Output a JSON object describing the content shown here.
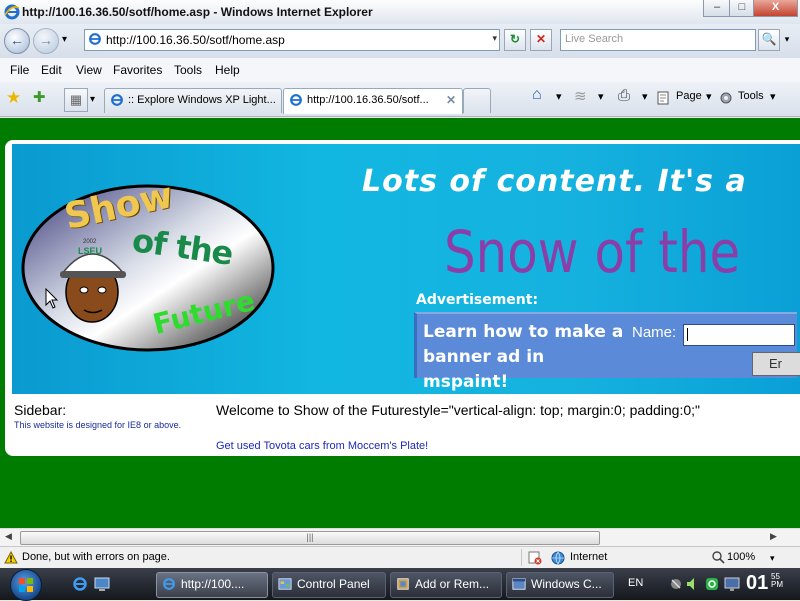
{
  "window": {
    "title": "http://100.16.36.50/sotf/home.asp - Windows Internet Explorer",
    "minimize": "–",
    "maximize": "□",
    "close": "X"
  },
  "navbar": {
    "back": "←",
    "forward": "→",
    "recent_dropdown": "▾",
    "address": "http://100.16.36.50/sotf/home.asp",
    "address_dropdown": "▾",
    "refresh": "↻",
    "stop": "✕",
    "search_placeholder": "Live Search",
    "search_button": "🔍",
    "search_dropdown": "▾"
  },
  "menu": [
    "File",
    "Edit",
    "View",
    "Favorites",
    "Tools",
    "Help"
  ],
  "tabs": {
    "favorites_star": "★",
    "add_favorite": "✚",
    "quick_tabs": "▦",
    "quick_tabs_dropdown": "▾",
    "items": [
      {
        "label": ":: Explore Windows XP Light...",
        "active": false
      },
      {
        "label": "http://100.16.36.50/sotf...",
        "active": true,
        "close": "✕"
      }
    ],
    "commands": {
      "home": "⌂",
      "feeds": "≋",
      "print": "⎙",
      "page": "Page",
      "tools": "Tools",
      "dropdown": "▾"
    }
  },
  "page": {
    "logo": {
      "show": "Show",
      "of_the": "of the",
      "future": "Future",
      "cap_text": "LSEU",
      "cap_year": "2002"
    },
    "tagline": "Lots of content. It's a",
    "big_title": "Snow of the",
    "ad_label": "Advertisement:",
    "ad_text": "Learn how to make a banner ad in mspaint!",
    "name_label": "Name:",
    "name_value": "",
    "enter_button": "Er",
    "sidebar_title": "Sidebar:",
    "sidebar_note": "This website is designed for IE8 or above.",
    "welcome": "Welcome to Show of the Futurestyle=\"vertical-align: top; margin:0; padding:0;\"",
    "ad_link": "Get used Toyota cars from Moccem's Plate!"
  },
  "scrollbar": {
    "left": "◀",
    "right": "▶",
    "grip": "|||"
  },
  "status": {
    "text": "Done, but with errors on page.",
    "zone": "Internet",
    "zoom": "100%",
    "zoom_dropdown": "▾"
  },
  "taskbar": {
    "buttons": [
      {
        "label": "http://100...."
      },
      {
        "label": "Control Panel"
      },
      {
        "label": "Add or Rem..."
      },
      {
        "label": "Windows C..."
      }
    ],
    "language": "EN",
    "clock_hour": "01",
    "clock_minutes": "55",
    "clock_period": "PM"
  }
}
